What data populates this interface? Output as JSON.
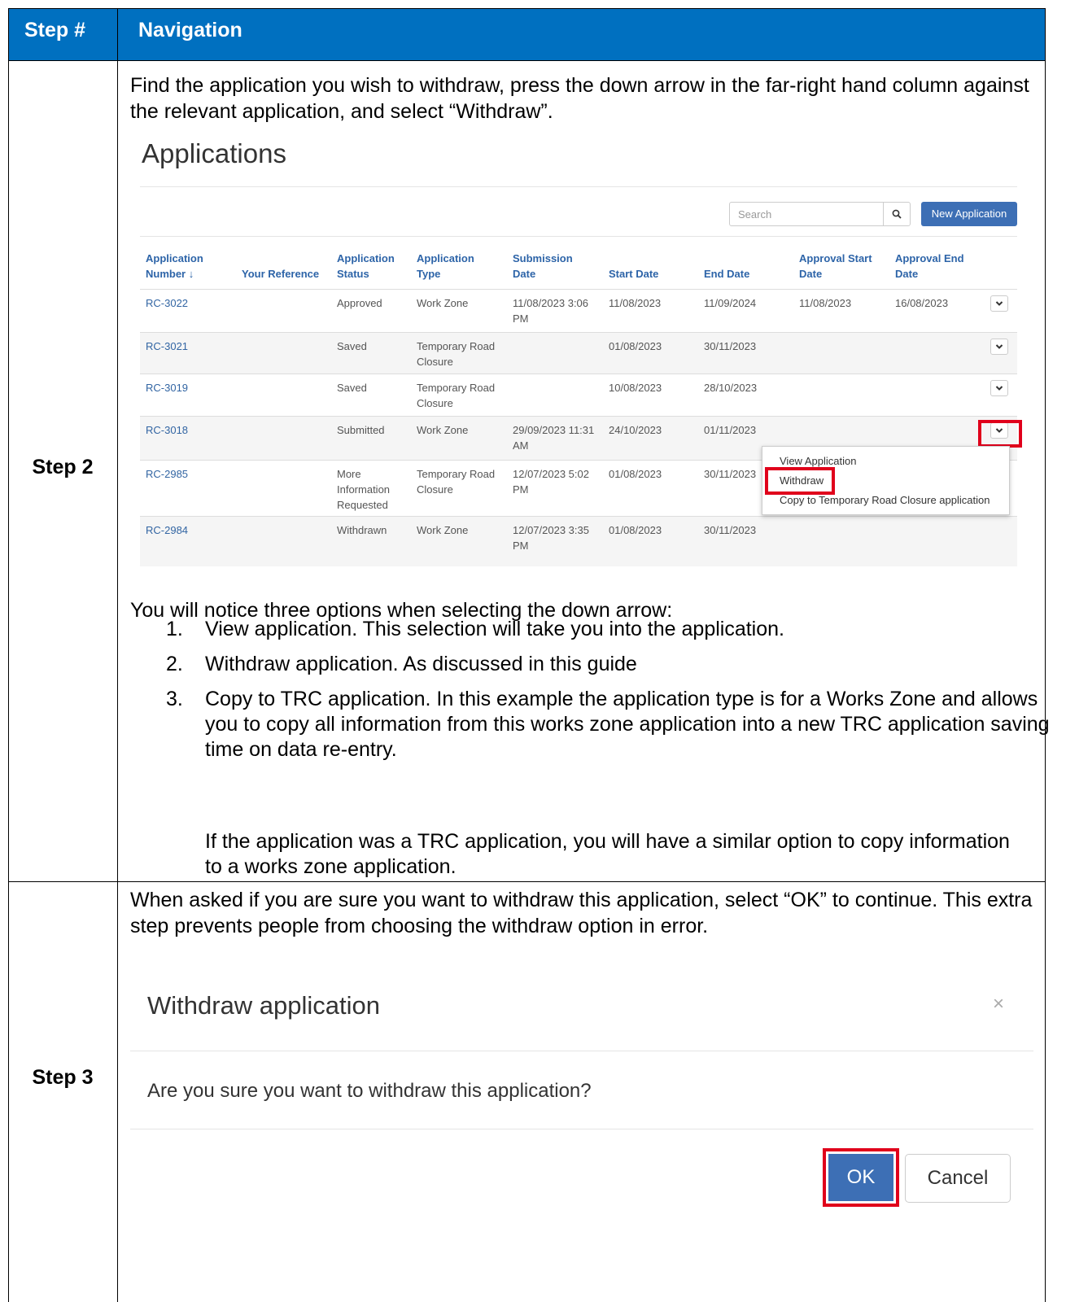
{
  "header": {
    "col1": "Step #",
    "col2": "Navigation"
  },
  "step2": {
    "label": "Step 2",
    "intro": "Find the application you wish to withdraw, press the down arrow in the far-right hand column against the relevant application, and select “Withdraw”.",
    "screenshot": {
      "title": "Applications",
      "search_placeholder": "Search",
      "new_button": "New Application",
      "columns": {
        "app_number_1": "Application",
        "app_number_2": "Number ↓",
        "your_ref": "Your Reference",
        "status_1": "Application",
        "status_2": "Status",
        "type_1": "Application",
        "type_2": "Type",
        "submission_1": "Submission",
        "submission_2": "Date",
        "start": "Start Date",
        "end": "End Date",
        "approval_start_1": "Approval Start",
        "approval_start_2": "Date",
        "approval_end_1": "Approval End",
        "approval_end_2": "Date"
      },
      "rows": [
        {
          "number": "RC-3022",
          "status": [
            "Approved"
          ],
          "type": [
            "Work Zone"
          ],
          "submission": [
            "11/08/2023 3:06",
            "PM"
          ],
          "start": "11/08/2023",
          "end": "11/09/2024",
          "approval_start": "11/08/2023",
          "approval_end": "16/08/2023"
        },
        {
          "number": "RC-3021",
          "status": [
            "Saved"
          ],
          "type": [
            "Temporary Road",
            "Closure"
          ],
          "submission": [
            "",
            ""
          ],
          "start": "01/08/2023",
          "end": "30/11/2023",
          "approval_start": "",
          "approval_end": ""
        },
        {
          "number": "RC-3019",
          "status": [
            "Saved"
          ],
          "type": [
            "Temporary Road",
            "Closure"
          ],
          "submission": [
            "",
            ""
          ],
          "start": "10/08/2023",
          "end": "28/10/2023",
          "approval_start": "",
          "approval_end": ""
        },
        {
          "number": "RC-3018",
          "status": [
            "Submitted"
          ],
          "type": [
            "Work Zone"
          ],
          "submission": [
            "29/09/2023 11:31",
            "AM"
          ],
          "start": "24/10/2023",
          "end": "01/11/2023",
          "approval_start": "",
          "approval_end": ""
        },
        {
          "number": "RC-2985",
          "status": [
            "More",
            "Information",
            "Requested"
          ],
          "type": [
            "Temporary Road",
            "Closure"
          ],
          "submission": [
            "12/07/2023 5:02",
            "PM"
          ],
          "start": "01/08/2023",
          "end": "30/11/2023",
          "approval_start": "",
          "approval_end": ""
        },
        {
          "number": "RC-2984",
          "status": [
            "Withdrawn"
          ],
          "type": [
            "Work Zone"
          ],
          "submission": [
            "12/07/2023 3:35",
            "PM"
          ],
          "start": "01/08/2023",
          "end": "30/11/2023",
          "approval_start": "",
          "approval_end": ""
        }
      ],
      "menu": [
        "View Application",
        "Withdraw",
        "Copy to Temporary Road Closure application"
      ]
    },
    "options_intro": "You will notice three options when selecting the down arrow:",
    "options": [
      {
        "num": "1.",
        "text": "View application.  This selection will take you into the application."
      },
      {
        "num": "2.",
        "text": "Withdraw application.  As discussed in this guide"
      },
      {
        "num": "3.",
        "text": "Copy to TRC application.  In this example the application type is for a Works Zone and allows you to copy all information from this works zone application into a new TRC application saving time on data re-entry."
      }
    ],
    "options_note": "If the application was a TRC application, you will have a similar option to copy information to a works zone application."
  },
  "step3": {
    "label": "Step 3",
    "intro": "When asked if you are sure you want to withdraw this application, select “OK” to continue. This extra step prevents people from choosing the withdraw option in error.",
    "dialog": {
      "title": "Withdraw application",
      "close": "×",
      "message": "Are you sure you want to withdraw this application?",
      "ok": "OK",
      "cancel": "Cancel"
    }
  },
  "colors": {
    "header_bg": "#0070c0",
    "highlight": "#e0001b",
    "primary_button": "#3d6fb5",
    "link": "#3265a3"
  }
}
